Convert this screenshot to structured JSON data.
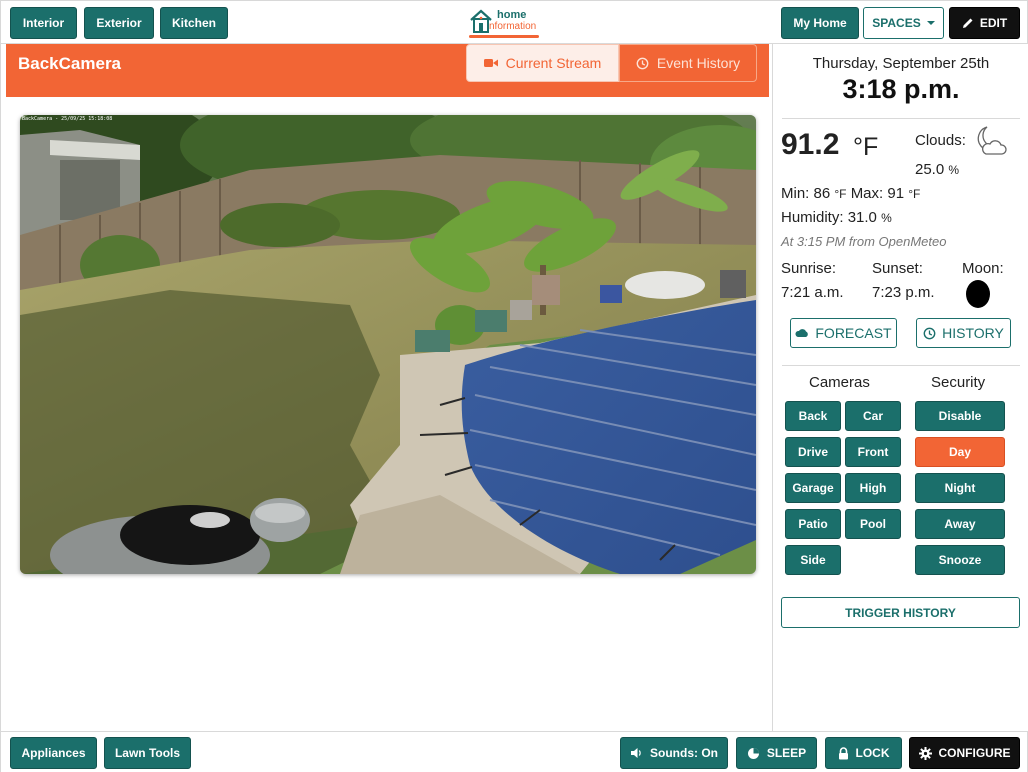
{
  "topbar": {
    "left_buttons": [
      "Interior",
      "Exterior",
      "Kitchen"
    ],
    "logo_line1": "home",
    "logo_line2": "nformation",
    "my_home": "My Home",
    "spaces": "SPACES",
    "edit": "EDIT"
  },
  "camera": {
    "title": "BackCamera",
    "tab_current": "Current Stream",
    "tab_history": "Event History",
    "overlay_text": "BackCamera - 25/09/25 15:18:08"
  },
  "weather": {
    "date": "Thursday, September 25th",
    "time": "3:18 p.m.",
    "temperature": "91.2",
    "temperature_unit": "°F",
    "clouds_label": "Clouds:",
    "clouds_value": "25.0",
    "clouds_unit": "%",
    "min_label": "Min:",
    "min_value": "86",
    "max_label": "Max:",
    "max_value": "91",
    "deg_unit": "°F",
    "humidity_label": "Humidity:",
    "humidity_value": "31.0",
    "humidity_unit": "%",
    "source": "At 3:15 PM from OpenMeteo",
    "sunrise_label": "Sunrise:",
    "sunrise_value": "7:21 a.m.",
    "sunset_label": "Sunset:",
    "sunset_value": "7:23 p.m.",
    "moon_label": "Moon:",
    "forecast_button": "FORECAST",
    "history_button": "HISTORY"
  },
  "cameras": {
    "heading": "Cameras",
    "items": [
      "Back",
      "Car",
      "Drive",
      "Front",
      "Garage",
      "High",
      "Patio",
      "Pool",
      "Side"
    ]
  },
  "security": {
    "heading": "Security",
    "items": [
      "Disable",
      "Day",
      "Night",
      "Away",
      "Snooze"
    ],
    "active": "Day"
  },
  "trigger_history": "TRIGGER HISTORY",
  "bottombar": {
    "appliances": "Appliances",
    "lawn_tools": "Lawn Tools",
    "sounds": "Sounds: On",
    "sleep": "SLEEP",
    "lock": "LOCK",
    "configure": "CONFIGURE"
  },
  "colors": {
    "teal": "#1b6f6b",
    "orange": "#f26535",
    "black": "#111111"
  }
}
